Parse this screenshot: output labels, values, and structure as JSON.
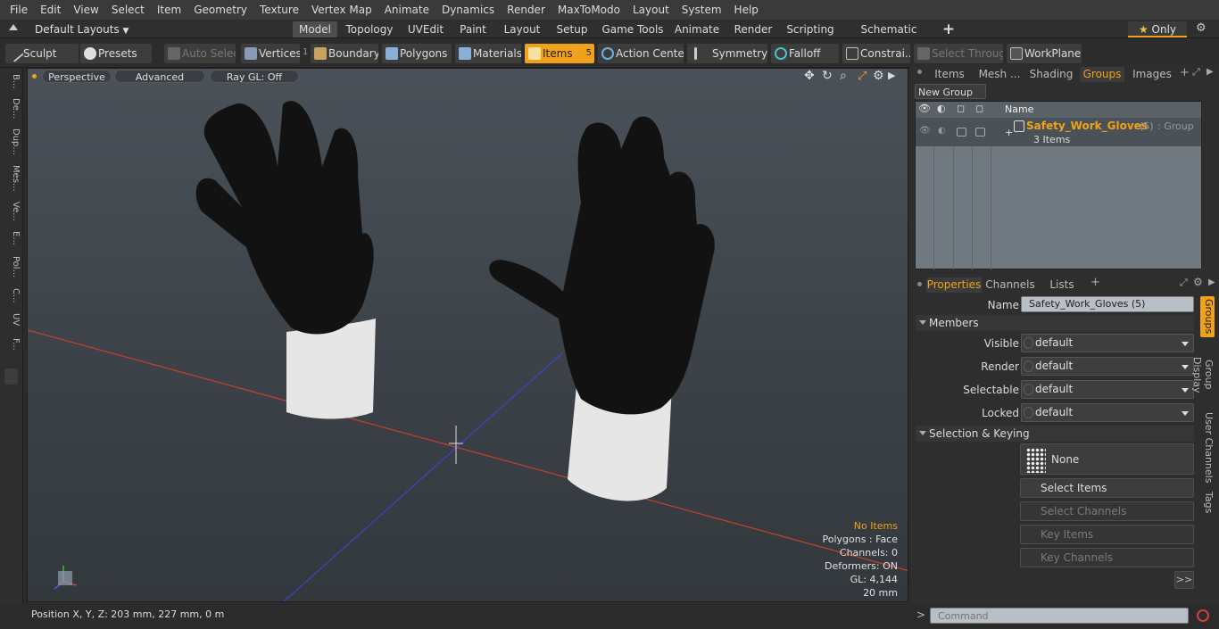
{
  "menubar": [
    "File",
    "Edit",
    "View",
    "Select",
    "Item",
    "Geometry",
    "Texture",
    "Vertex Map",
    "Animate",
    "Dynamics",
    "Render",
    "MaxToModo",
    "Layout",
    "System",
    "Help"
  ],
  "layouts": {
    "selector": "Default Layouts",
    "tabs": [
      "Model",
      "Topology",
      "UVEdit",
      "Paint",
      "Layout",
      "Setup",
      "Game Tools",
      "Animate",
      "Render",
      "Scripting",
      "Schematic Fusion"
    ],
    "active": "Model",
    "add": "+",
    "only": "Only"
  },
  "toolbar": {
    "sculpt": "Sculpt",
    "presets": "Presets",
    "auto_select": "Auto Select",
    "vertices": "Vertices",
    "vertices_count": "1",
    "boundary": "Boundary",
    "polygons": "Polygons",
    "materials": "Materials",
    "items": "Items",
    "items_count": "5",
    "action_center": "Action Center",
    "symmetry": "Symmetry",
    "falloff": "Falloff",
    "constraints": "Constrai...",
    "select_through": "Select Through",
    "workplane": "WorkPlane"
  },
  "left_tabs": [
    "B...",
    "De...",
    "Dup...",
    "Mes...",
    "Ve...",
    "E...",
    "Pol...",
    "C...",
    "UV",
    "F..."
  ],
  "viewport": {
    "view": "Perspective",
    "shading": "Advanced",
    "raygl": "Ray GL: Off",
    "info": {
      "selection": "No Items",
      "polygons": "Polygons : Face",
      "channels": "Channels: 0",
      "deformers": "Deformers: ON",
      "gl": "GL: 4,144",
      "scale": "20 mm"
    },
    "colors": {
      "x_axis": "#c8402a",
      "z_axis": "#3a44c8",
      "glove_palm": "#121212",
      "cuff": "#e6e6e6",
      "highlight": "#f0a21a"
    }
  },
  "status": {
    "position": "Position X, Y, Z:   203 mm, 227 mm, 0 m"
  },
  "groups_panel": {
    "tabs": [
      "Items",
      "Mesh ...",
      "Shading",
      "Groups",
      "Images"
    ],
    "active": "Groups",
    "new_group": "New Group",
    "col_name": "Name",
    "group_name": "Safety_Work_Gloves",
    "group_count": "(5)",
    "group_type": ": Group",
    "group_items": "3 Items"
  },
  "properties_panel": {
    "tabs": [
      "Properties",
      "Channels",
      "Lists"
    ],
    "active": "Properties",
    "name_label": "Name",
    "name_value": "Safety_Work_Gloves (5)",
    "members_header": "Members",
    "visible_label": "Visible",
    "visible_value": "default",
    "render_label": "Render",
    "render_value": "default",
    "selectable_label": "Selectable",
    "selectable_value": "default",
    "locked_label": "Locked",
    "locked_value": "default",
    "selection_header": "Selection & Keying",
    "none_label": "None",
    "select_items": "Select Items",
    "select_channels": "Select Channels",
    "key_items": "Key Items",
    "key_channels": "Key Channels",
    "more": ">>",
    "side_tabs": [
      "Groups",
      "Group Display",
      "User Channels",
      "Tags"
    ]
  },
  "command": {
    "prompt": ">",
    "placeholder": "Command"
  }
}
